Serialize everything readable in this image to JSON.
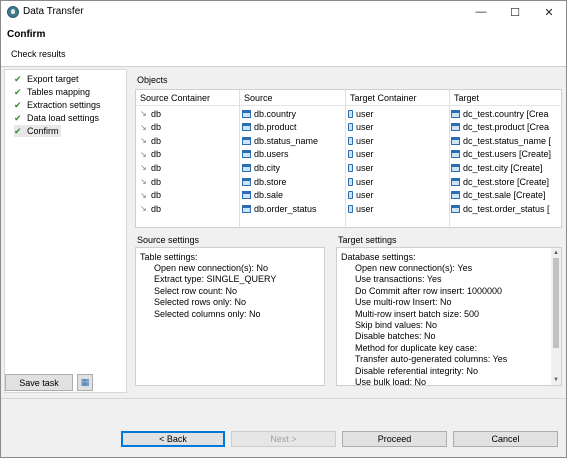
{
  "window": {
    "title": "Data Transfer"
  },
  "header": {
    "title": "Confirm",
    "subtitle": "Check results"
  },
  "nav": {
    "items": [
      {
        "label": "Export target"
      },
      {
        "label": "Tables mapping"
      },
      {
        "label": "Extraction settings"
      },
      {
        "label": "Data load settings"
      },
      {
        "label": "Confirm"
      }
    ]
  },
  "left_footer": {
    "save_task_label": "Save task"
  },
  "objects": {
    "label": "Objects",
    "columns": [
      "Source Container",
      "Source",
      "Target Container",
      "Target"
    ],
    "rows": [
      {
        "source_container": "db",
        "source": "db.country",
        "target_container": "user",
        "target": "dc_test.country [Crea"
      },
      {
        "source_container": "db",
        "source": "db.product",
        "target_container": "user",
        "target": "dc_test.product [Crea"
      },
      {
        "source_container": "db",
        "source": "db.status_name",
        "target_container": "user",
        "target": "dc_test.status_name ["
      },
      {
        "source_container": "db",
        "source": "db.users",
        "target_container": "user",
        "target": "dc_test.users [Create]"
      },
      {
        "source_container": "db",
        "source": "db.city",
        "target_container": "user",
        "target": "dc_test.city [Create]"
      },
      {
        "source_container": "db",
        "source": "db.store",
        "target_container": "user",
        "target": "dc_test.store [Create]"
      },
      {
        "source_container": "db",
        "source": "db.sale",
        "target_container": "user",
        "target": "dc_test.sale [Create]"
      },
      {
        "source_container": "db",
        "source": "db.order_status",
        "target_container": "user",
        "target": "dc_test.order_status ["
      }
    ]
  },
  "source_settings": {
    "label": "Source settings",
    "heading": "Table settings:",
    "lines": [
      "Open new connection(s): No",
      "Extract type: SINGLE_QUERY",
      "Select row count: No",
      "Selected rows only: No",
      "Selected columns only: No"
    ]
  },
  "target_settings": {
    "label": "Target settings",
    "heading": "Database settings:",
    "lines": [
      "Open new connection(s): Yes",
      "Use transactions: Yes",
      "Do Commit after row insert: 1000000",
      "Use multi-row Insert: No",
      "Multi-row insert batch size: 500",
      "Skip bind values: No",
      "Disable batches: No",
      "Method for duplicate key case:",
      "Transfer auto-generated columns: Yes",
      "Disable referential integrity: No",
      "Use bulk load: No"
    ]
  },
  "buttons": {
    "back_label": "< Back",
    "next_label": "Next >",
    "proceed_label": "Proceed",
    "cancel_label": "Cancel"
  },
  "colors": {
    "accent": "#0078d7",
    "check": "#3a8a3a",
    "icon_blue": "#2a6db0"
  }
}
